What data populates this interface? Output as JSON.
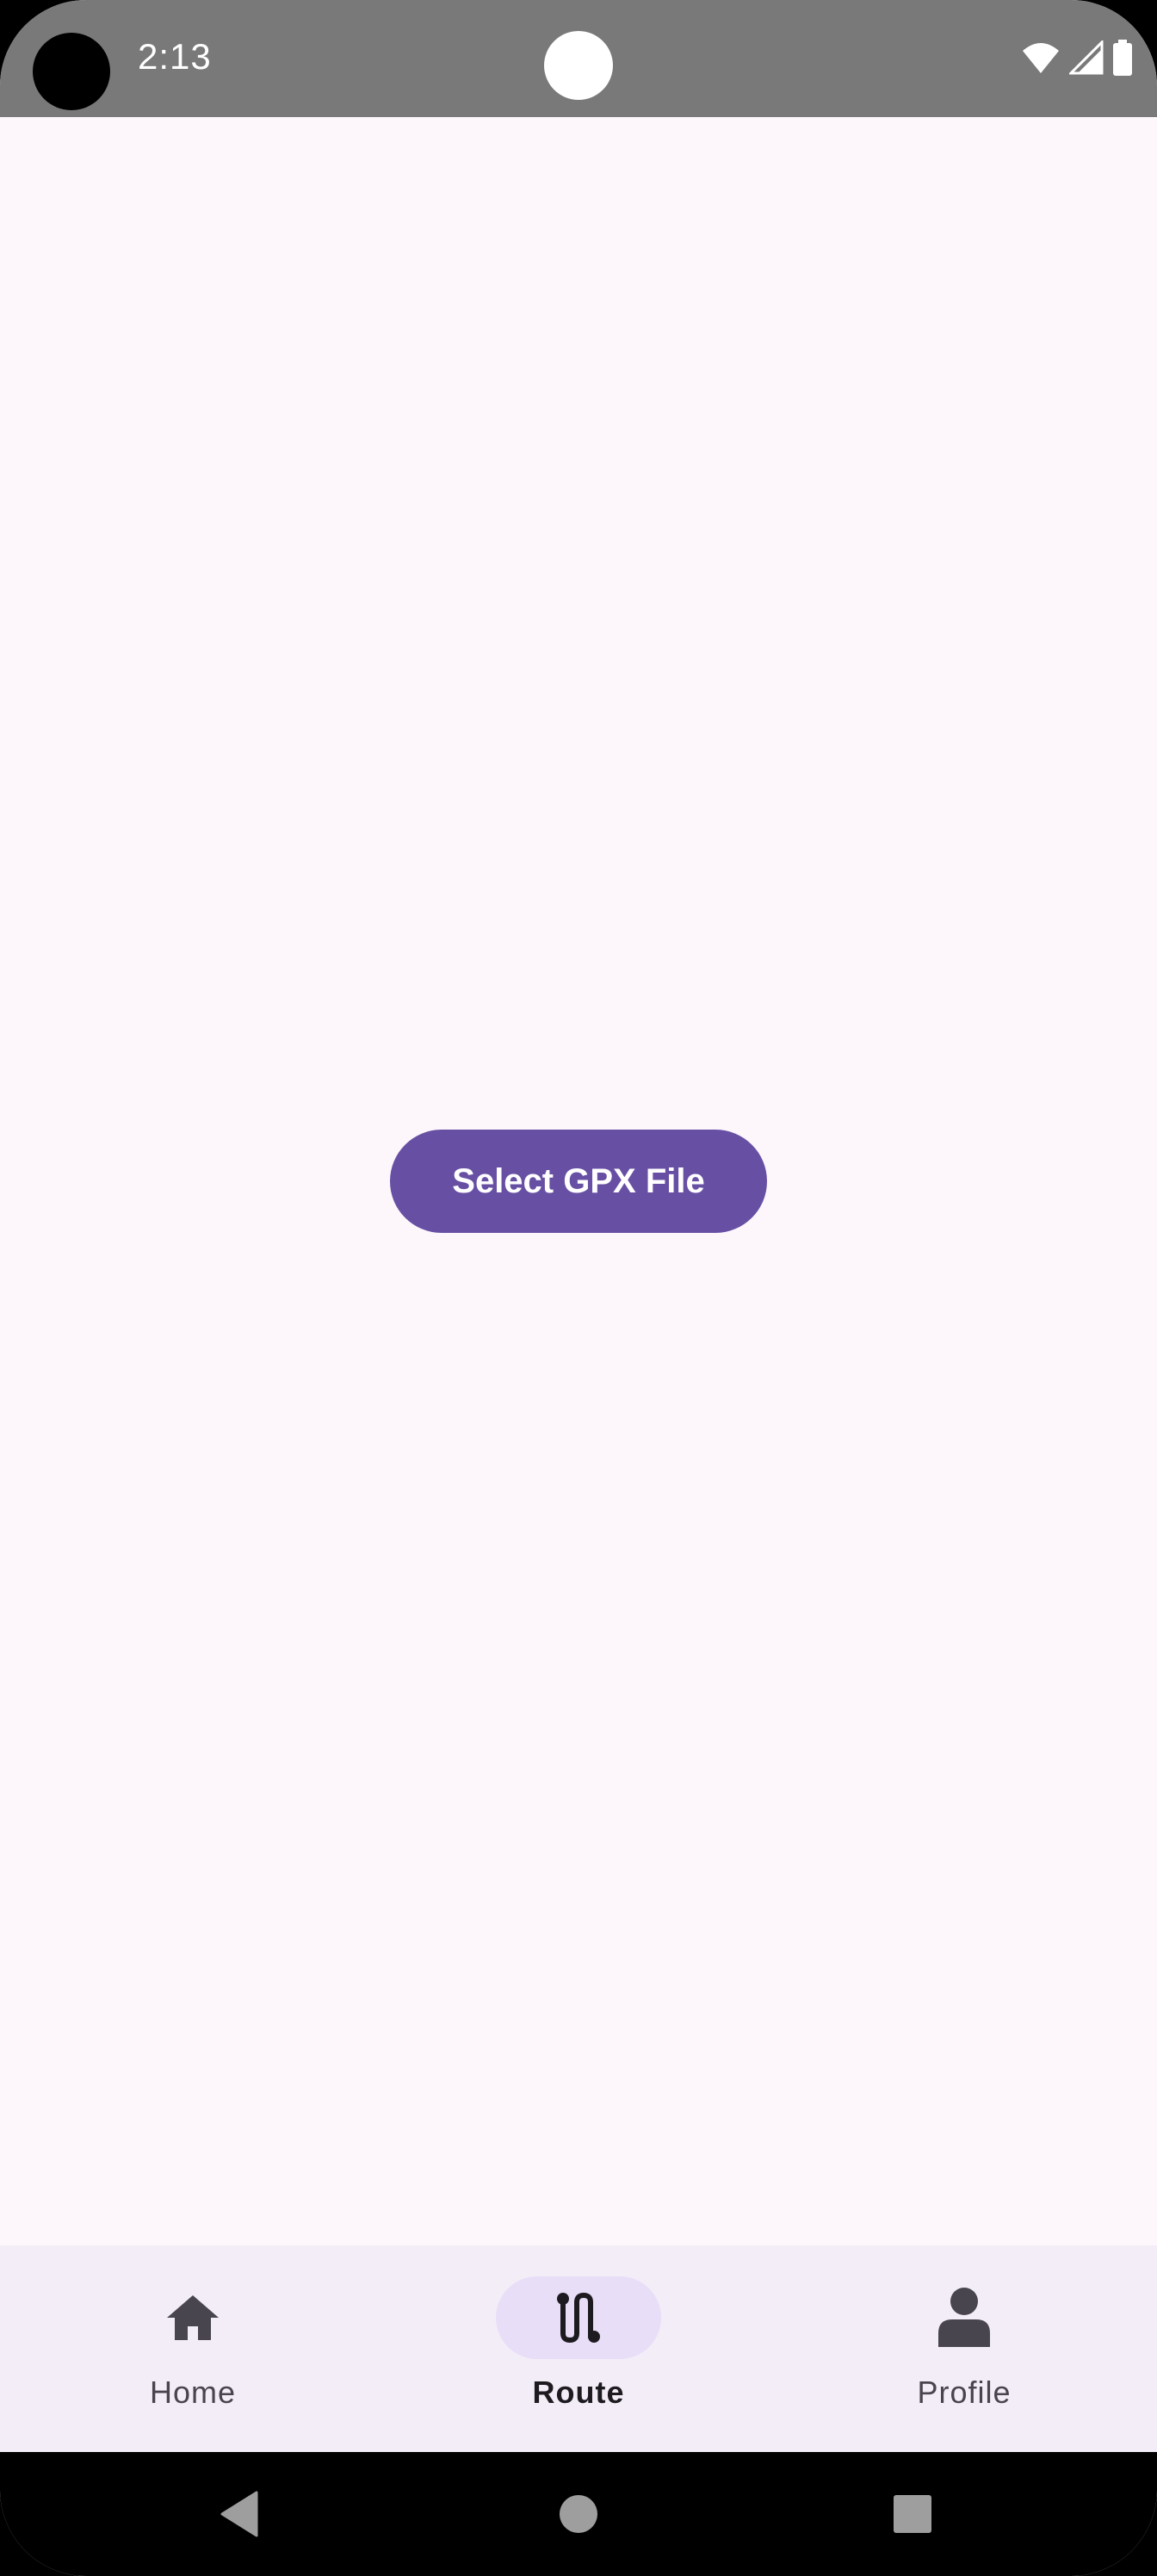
{
  "status_bar": {
    "time": "2:13",
    "icons": [
      "wifi-icon",
      "cell-signal-icon",
      "battery-icon"
    ]
  },
  "main": {
    "select_button_label": "Select GPX File"
  },
  "bottom_nav": {
    "items": [
      {
        "label": "Home",
        "icon": "home-icon",
        "selected": false
      },
      {
        "label": "Route",
        "icon": "route-icon",
        "selected": true
      },
      {
        "label": "Profile",
        "icon": "person-icon",
        "selected": false
      }
    ]
  },
  "system_nav": {
    "buttons": [
      "back-icon",
      "home-circle-icon",
      "recents-icon"
    ]
  },
  "colors": {
    "primary": "#6750a4",
    "background": "#fdf7fc",
    "nav_background": "#f3edf7",
    "nav_indicator": "#e8def8",
    "status_bar": "#797979"
  }
}
